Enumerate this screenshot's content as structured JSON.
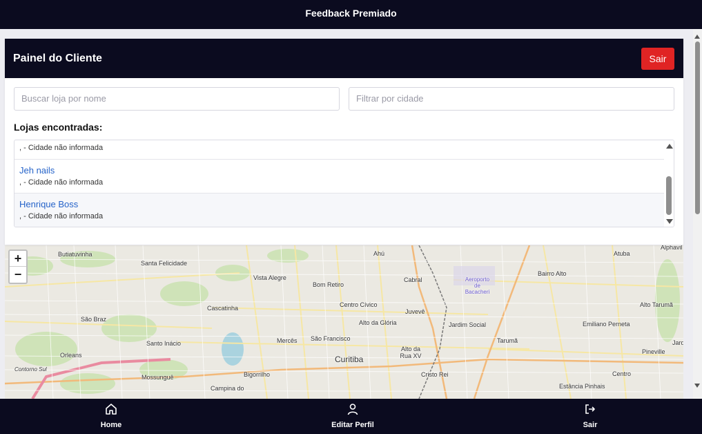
{
  "app": {
    "title": "Feedback Premiado"
  },
  "panel": {
    "title": "Painel do Cliente",
    "logout_label": "Sair"
  },
  "search": {
    "store_placeholder": "Buscar loja por nome",
    "city_placeholder": "Filtrar por cidade"
  },
  "stores": {
    "heading": "Lojas encontradas:",
    "partial_row": ", - Cidade não informada",
    "items": [
      {
        "name": "Jeh nails",
        "city": ", - Cidade não informada"
      },
      {
        "name": "Henrique Boss",
        "city": ", - Cidade não informada"
      }
    ]
  },
  "map": {
    "zoom_in": "+",
    "zoom_out": "−",
    "labels": {
      "butiatuvinha": "Butiatuvinha",
      "santa_felicidade": "Santa Felicidade",
      "ahu": "Ahú",
      "atuba": "Atuba",
      "alphaville": "Alphavil",
      "vista_alegre": "Vista Alegre",
      "bom_retiro": "Bom Retiro",
      "cabral": "Cabral",
      "bairro_alto": "Bairro Alto",
      "aeroporto": "Aeroporto de Bacacheri",
      "centro_civico": "Centro Cívico",
      "cascatinha": "Cascatinha",
      "juveve": "Juvevê",
      "alto_taruma": "Alto Tarumã",
      "sao_braz": "São Braz",
      "alto_da_gloria": "Alto da Glória",
      "jardim_social": "Jardim Social",
      "emiliano_perneta": "Emiliano Perneta",
      "santo_inacio": "Santo Inácio",
      "merces": "Mercês",
      "sao_francisco": "São Francisco",
      "taruma": "Tarumã",
      "jard": "Jard",
      "orleans": "Orleans",
      "curitiba": "Curitiba",
      "alto_da_rua_xv": "Alto da Rua XV",
      "pineville": "Pineville",
      "contorno_sul": "Contorno Sul",
      "mossungue": "Mossunguê",
      "bigorrilho": "Bigorrilho",
      "cristo_rei": "Cristo Rei",
      "centro": "Centro",
      "campina_do": "Campina do",
      "estancia_pinhais": "Estância Pinhais"
    }
  },
  "bottom_nav": {
    "home": "Home",
    "edit_profile": "Editar Perfil",
    "logout": "Sair"
  },
  "colors": {
    "navy": "#0b0b1f",
    "danger": "#e02424",
    "link": "#2563c9"
  }
}
